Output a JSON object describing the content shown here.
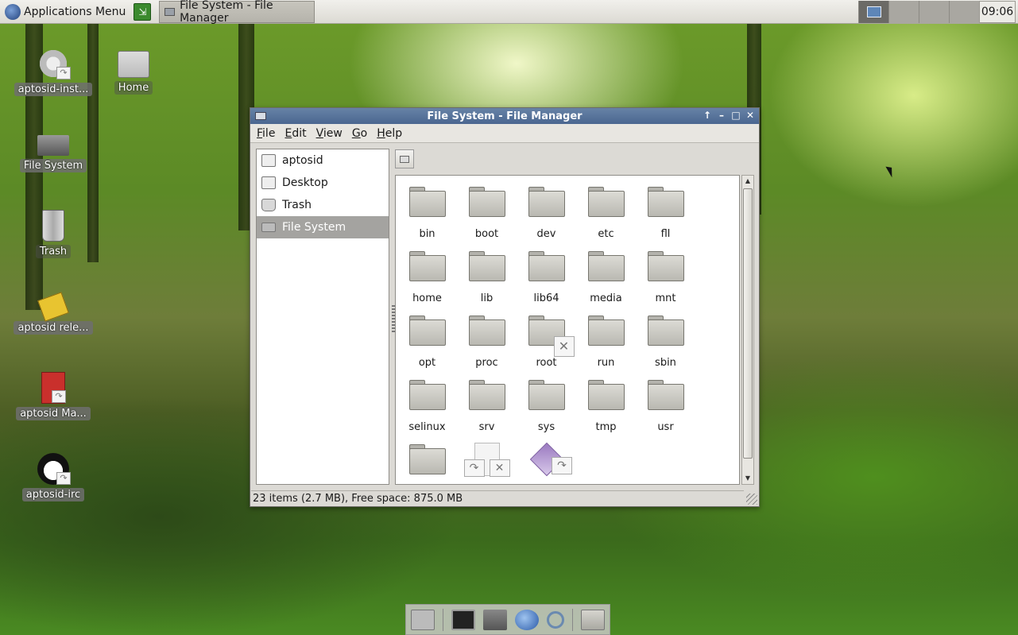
{
  "panel": {
    "app_menu_label": "Applications Menu",
    "task_title": "File System - File Manager",
    "clock": "09:06"
  },
  "desktop_icons": [
    {
      "label": "aptosid-inst...",
      "icon": "installer-icon"
    },
    {
      "label": "Home",
      "icon": "home-folder-icon"
    },
    {
      "label": "File System",
      "icon": "drive-icon"
    },
    {
      "label": "Trash",
      "icon": "trash-icon"
    },
    {
      "label": "aptosid rele...",
      "icon": "release-notes-icon"
    },
    {
      "label": "aptosid Ma...",
      "icon": "manual-icon"
    },
    {
      "label": "aptosid-irc",
      "icon": "irc-icon"
    }
  ],
  "window": {
    "title": "File System - File Manager",
    "menu": [
      "File",
      "Edit",
      "View",
      "Go",
      "Help"
    ]
  },
  "sidebar": {
    "items": [
      {
        "label": "aptosid",
        "icon": "home-icon"
      },
      {
        "label": "Desktop",
        "icon": "desktop-icon"
      },
      {
        "label": "Trash",
        "icon": "trash-icon"
      },
      {
        "label": "File System",
        "icon": "drive-icon",
        "selected": true
      }
    ]
  },
  "files": [
    "bin",
    "boot",
    "dev",
    "etc",
    "fll",
    "home",
    "lib",
    "lib64",
    "media",
    "mnt",
    "opt",
    "proc",
    "root",
    "run",
    "sbin",
    "selinux",
    "srv",
    "sys",
    "tmp",
    "usr"
  ],
  "status": "23 items (2.7 MB), Free space: 875.0 MB",
  "colors": {
    "titlebar": "#4a6690",
    "selected_row": "#a4a3a0",
    "window_bg": "#dcdad5"
  }
}
